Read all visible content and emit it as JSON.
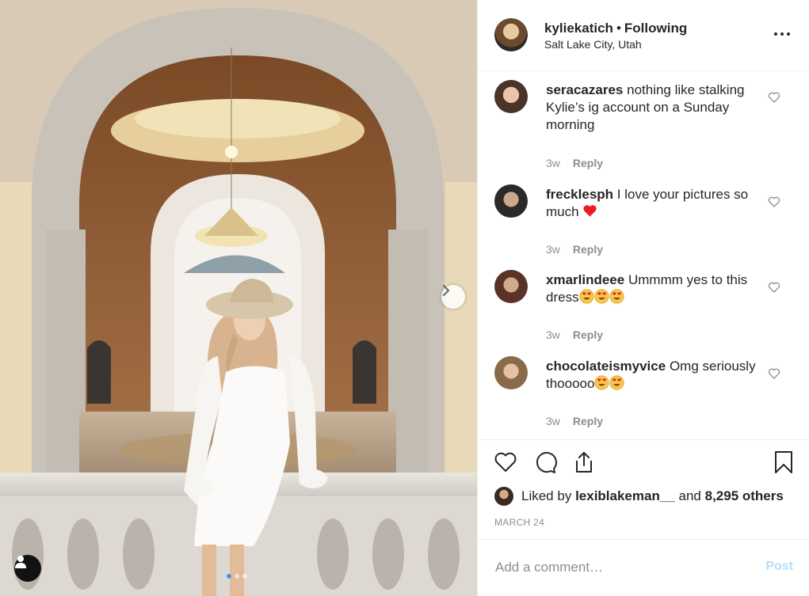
{
  "post": {
    "username": "kyliekatich",
    "separator": "•",
    "follow_status": "Following",
    "location": "Salt Lake City, Utah",
    "more_icon": "more-horizontal-icon"
  },
  "carousel": {
    "total_slides": 3,
    "active_slide": 1,
    "next_icon": "chevron-right-icon",
    "user_tag_icon": "user-icon"
  },
  "comments": [
    {
      "username": "seracazares",
      "text": "nothing like stalking Kylie’s ig account on a Sunday morning",
      "emojis": [],
      "time": "3w",
      "reply": "Reply"
    },
    {
      "username": "frecklesph",
      "text": "I love your pictures so much",
      "emojis": [
        "red-heart"
      ],
      "time": "3w",
      "reply": "Reply"
    },
    {
      "username": "xmarlindeee",
      "text": "Ummmm yes to this dress",
      "emojis": [
        "heart-eyes",
        "heart-eyes",
        "heart-eyes"
      ],
      "time": "3w",
      "reply": "Reply"
    },
    {
      "username": "chocolateismyvice",
      "text": "Omg seriously thooooo",
      "emojis": [
        "heart-eyes",
        "heart-eyes"
      ],
      "time": "3w",
      "reply": "Reply"
    }
  ],
  "actions": {
    "like_icon": "heart-icon",
    "comment_icon": "comment-icon",
    "share_icon": "share-icon",
    "save_icon": "bookmark-icon"
  },
  "likes": {
    "prefix": "Liked by",
    "user": "lexiblakeman__",
    "conjunction": "and",
    "others": "8,295 others"
  },
  "date": "MARCH 24",
  "add_comment": {
    "placeholder": "Add a comment…",
    "post_label": "Post"
  },
  "colors": {
    "link_blue": "#3897f0",
    "post_disabled": "#b2dffc",
    "muted_text": "#8e8e8e",
    "emoji_heart_red": "#ed1c24"
  }
}
